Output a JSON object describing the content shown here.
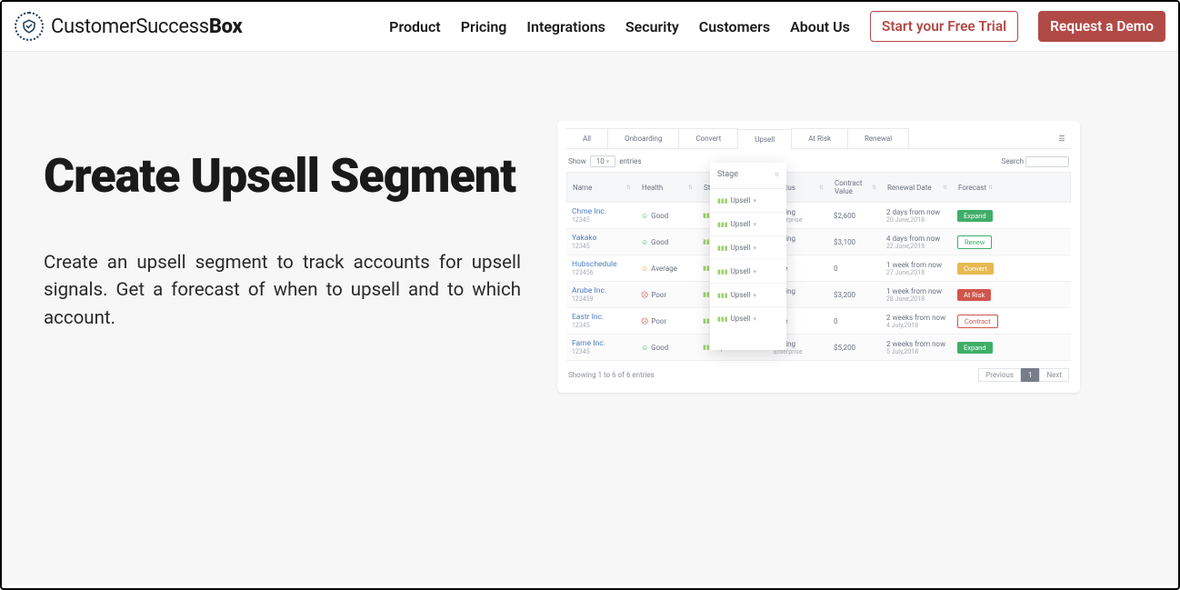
{
  "brand": {
    "name_text": "CustomerSuccess",
    "name_bold": "Box"
  },
  "nav": {
    "links": [
      "Product",
      "Pricing",
      "Integrations",
      "Security",
      "Customers",
      "About Us"
    ],
    "cta_outline": "Start your Free Trial",
    "cta_primary": "Request a Demo"
  },
  "hero": {
    "title": "Create Upsell Segment",
    "desc": "Create an upsell segment to track accounts for upsell signals. Get a forecast of when to upsell and to which account."
  },
  "panel": {
    "tabs": [
      "All",
      "Onboarding",
      "Convert",
      "Upsell",
      "At Risk",
      "Renewal"
    ],
    "active_tab": "Upsell",
    "toolbar": {
      "show": "Show",
      "count": "10",
      "entries": "entries",
      "search_label": "Search"
    },
    "columns": [
      "Name",
      "Health",
      "Stage",
      "Status",
      "Contract Value",
      "Renewal Date",
      "Forecast"
    ],
    "stage_label": "Stage",
    "rows": [
      {
        "name": "Chme Inc.",
        "id": "12345",
        "health": "Good",
        "health_class": "good",
        "stage": "Upsell",
        "status": "Paying",
        "status_sub": "Enterprise",
        "cv": "$2,600",
        "renew": "2 days from now",
        "renew_sub": "20 June,2018",
        "forecast": "Expand",
        "fclass": "b-expand"
      },
      {
        "name": "Yakako",
        "id": "12345",
        "health": "Good",
        "health_class": "good",
        "stage": "Upsell",
        "status": "Paying",
        "status_sub": "Pro",
        "cv": "$3,100",
        "renew": "4 days from now",
        "renew_sub": "22 June,2018",
        "forecast": "Renew",
        "fclass": "b-renew"
      },
      {
        "name": "Hubschedule",
        "id": "123456",
        "health": "Average",
        "health_class": "avg",
        "stage": "Upsell",
        "status": "Free",
        "status_sub": "",
        "cv": "0",
        "renew": "1 week from now",
        "renew_sub": "27 June,2018",
        "forecast": "Convert",
        "fclass": "b-convert"
      },
      {
        "name": "Arube Inc.",
        "id": "123459",
        "health": "Poor",
        "health_class": "poor",
        "stage": "Upsell",
        "status": "Paying",
        "status_sub": "Pro",
        "cv": "$3,200",
        "renew": "1 week from now",
        "renew_sub": "28 June,2018",
        "forecast": "At Risk",
        "fclass": "b-risk"
      },
      {
        "name": "Eastr Inc.",
        "id": "12345",
        "health": "Poor",
        "health_class": "poor",
        "stage": "Upsell",
        "status": "Free",
        "status_sub": "",
        "cv": "0",
        "renew": "2 weeks from now",
        "renew_sub": "4 July,2018",
        "forecast": "Contract",
        "fclass": "b-contract"
      },
      {
        "name": "Fame Inc.",
        "id": "12345",
        "health": "Good",
        "health_class": "good",
        "stage": "Upsell",
        "status": "Paying",
        "status_sub": "Enterprise",
        "cv": "$5,200",
        "renew": "2 weeks from now",
        "renew_sub": "5 July,2018",
        "forecast": "Expand",
        "fclass": "b-expand"
      }
    ],
    "footer": {
      "summary": "Showing 1 to 6 of 6 entries",
      "prev": "Previous",
      "page": "1",
      "next": "Next"
    }
  }
}
